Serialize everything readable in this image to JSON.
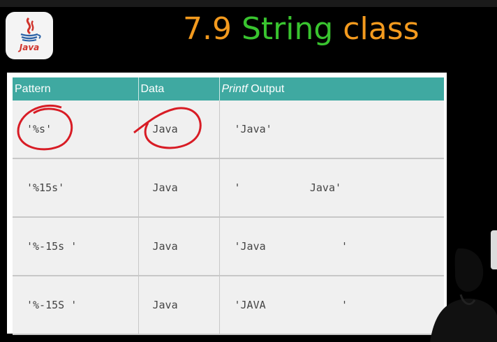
{
  "header": {
    "title_number": "7.9",
    "title_word1": "String",
    "title_word2": "class",
    "logo_text": "Java"
  },
  "table": {
    "headers": [
      "Pattern",
      "Data",
      "Printf",
      "Output"
    ],
    "rows": [
      {
        "pattern": "'%s'",
        "data": "Java",
        "output": "'Java'"
      },
      {
        "pattern": "'%15s'",
        "data": "Java",
        "output": "'           Java'"
      },
      {
        "pattern": "'%-15s '",
        "data": "Java",
        "output": "'Java            '"
      },
      {
        "pattern": "'%-15S '",
        "data": "Java",
        "output": "'JAVA            '"
      }
    ]
  },
  "colors": {
    "header_teal": "#3fa9a1",
    "title_orange": "#f39a1e",
    "title_green": "#39c42f",
    "annotation_red": "#d81c25"
  },
  "icons": [
    "java-logo-icon",
    "red-circle-annotation"
  ]
}
